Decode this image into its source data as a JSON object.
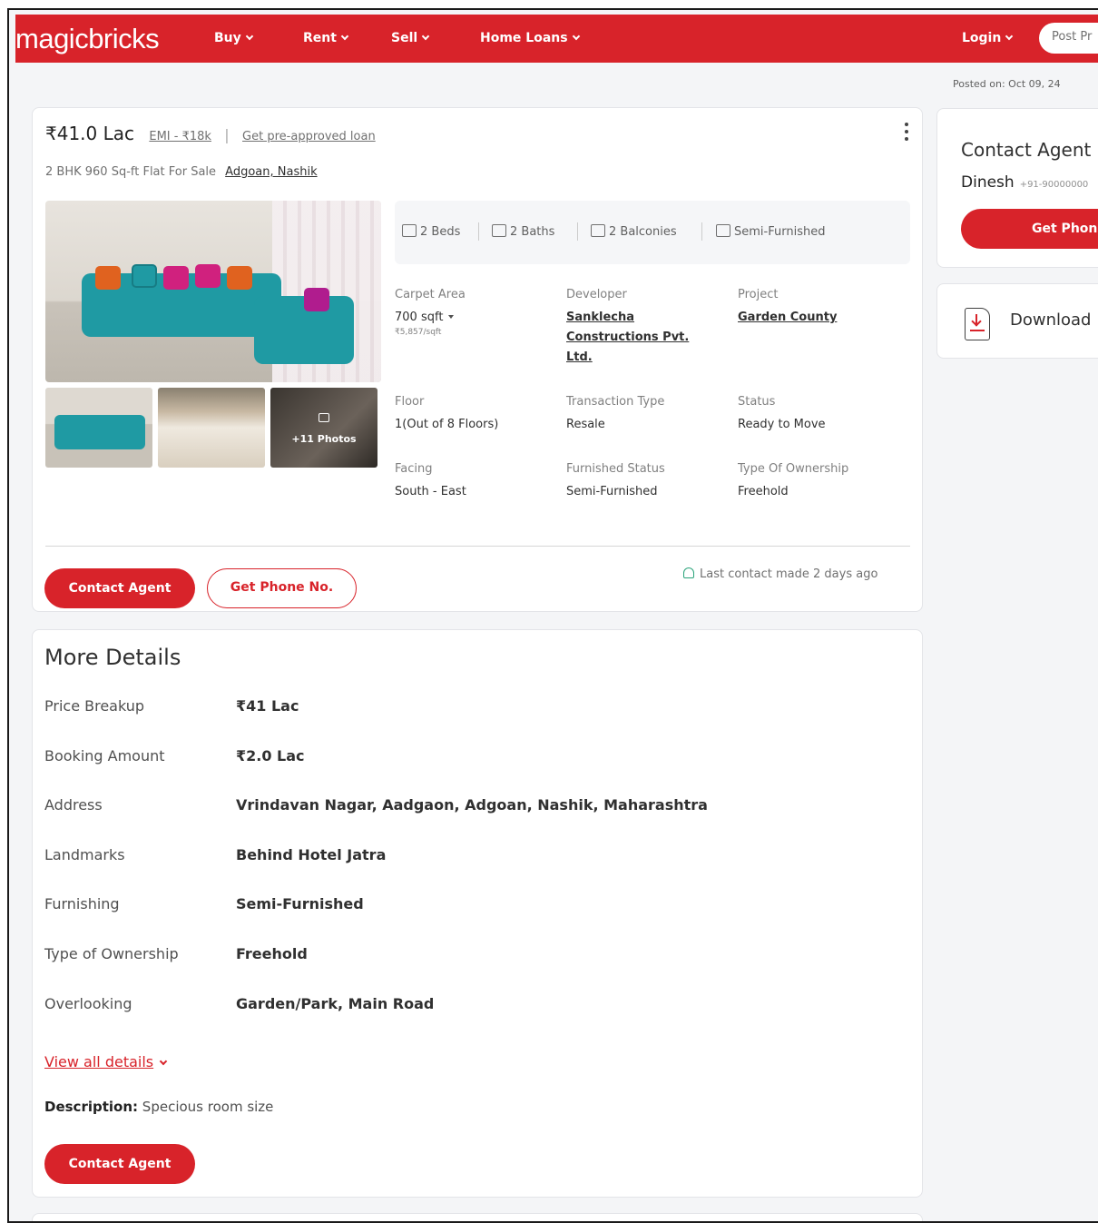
{
  "header": {
    "logo": "magicbricks",
    "nav": [
      "Buy",
      "Rent",
      "Sell",
      "Home Loans"
    ],
    "login": "Login",
    "post_button": "Post Pr"
  },
  "posted_on": "Posted on: Oct 09, 24",
  "listing": {
    "price": "₹41.0 Lac",
    "emi": "EMI - ₹18k",
    "separator": "|",
    "loan_link": "Get pre-approved loan",
    "subtitle": "2 BHK 960 Sq-ft Flat For Sale",
    "location": "Adgoan, Nashik",
    "photos_more": "+11 Photos",
    "amenities": [
      "2 Beds",
      "2 Baths",
      "2 Balconies",
      "Semi-Furnished"
    ],
    "details": [
      {
        "label": "Carpet Area",
        "value": "700 sqft",
        "sub": "₹5,857/sqft"
      },
      {
        "label": "Developer",
        "value": "Sanklecha Constructions Pvt. Ltd."
      },
      {
        "label": "Project",
        "value": "Garden County"
      },
      {
        "label": "Floor",
        "value": "1(Out of 8 Floors)"
      },
      {
        "label": "Transaction Type",
        "value": "Resale"
      },
      {
        "label": "Status",
        "value": "Ready to Move"
      },
      {
        "label": "Facing",
        "value": "South - East"
      },
      {
        "label": "Furnished Status",
        "value": "Semi-Furnished"
      },
      {
        "label": "Type Of Ownership",
        "value": "Freehold"
      }
    ],
    "contact_button": "Contact Agent",
    "phone_button": "Get Phone No.",
    "last_contact": "Last contact made 2 days ago"
  },
  "more_details": {
    "title": "More Details",
    "rows": [
      {
        "key": "Price Breakup",
        "value": "₹41 Lac"
      },
      {
        "key": "Booking Amount",
        "value": "₹2.0 Lac"
      },
      {
        "key": "Address",
        "value": "Vrindavan Nagar, Aadgaon, Adgoan, Nashik, Maharashtra"
      },
      {
        "key": "Landmarks",
        "value": "Behind Hotel Jatra"
      },
      {
        "key": "Furnishing",
        "value": "Semi-Furnished"
      },
      {
        "key": "Type of Ownership",
        "value": "Freehold"
      },
      {
        "key": "Overlooking",
        "value": "Garden/Park, Main Road"
      }
    ],
    "view_all": "View all details",
    "description_label": "Description:",
    "description": "Specious room size",
    "contact_button": "Contact Agent"
  },
  "sidebar": {
    "agent_title": "Contact Agent",
    "agent_name": "Dinesh",
    "agent_phone": "+91-90000000",
    "get_phone": "Get Phon",
    "download": "Download"
  },
  "colors": {
    "brand": "#d8232a",
    "accent_green": "#2aa37a"
  }
}
